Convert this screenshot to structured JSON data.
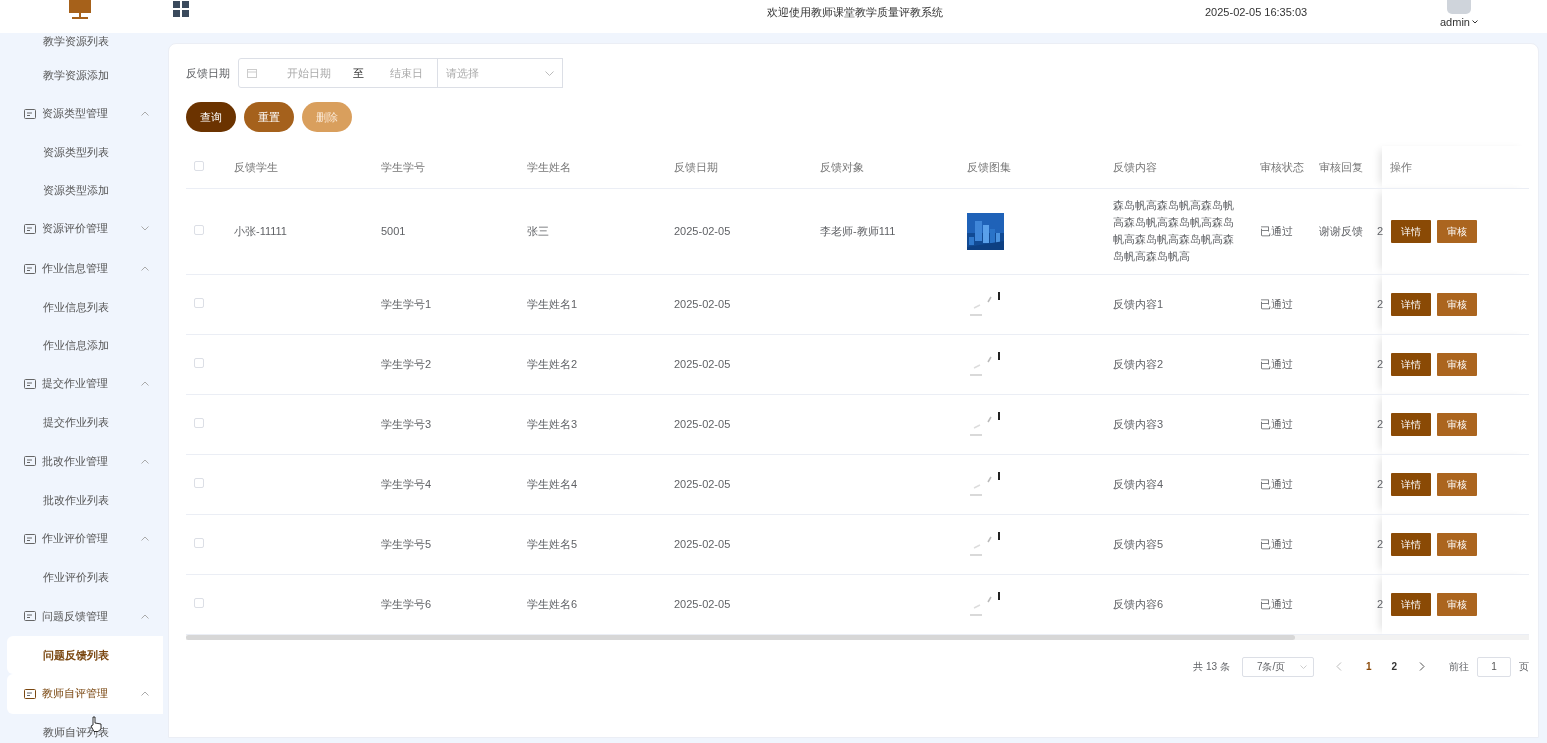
{
  "header": {
    "title": "欢迎使用教师课堂教学质量评教系统",
    "datetime": "2025-02-05 16:35:03",
    "user": "admin"
  },
  "sidebar": {
    "items": [
      {
        "label": "教学资源列表",
        "selected": false
      },
      {
        "label": "教学资源添加",
        "selected": false
      },
      {
        "label": "资源类型管理",
        "expanded": true,
        "children": [
          {
            "label": "资源类型列表",
            "selected": false
          },
          {
            "label": "资源类型添加",
            "selected": false
          }
        ]
      },
      {
        "label": "资源评价管理",
        "expanded": false
      },
      {
        "label": "作业信息管理",
        "expanded": true,
        "children": [
          {
            "label": "作业信息列表",
            "selected": false
          },
          {
            "label": "作业信息添加",
            "selected": false
          }
        ]
      },
      {
        "label": "提交作业管理",
        "expanded": true,
        "children": [
          {
            "label": "提交作业列表",
            "selected": false
          }
        ]
      },
      {
        "label": "批改作业管理",
        "expanded": true,
        "children": [
          {
            "label": "批改作业列表",
            "selected": false
          }
        ]
      },
      {
        "label": "作业评价管理",
        "expanded": true,
        "children": [
          {
            "label": "作业评价列表",
            "selected": false
          }
        ]
      },
      {
        "label": "问题反馈管理",
        "expanded": true,
        "children": [
          {
            "label": "问题反馈列表",
            "selected": true
          }
        ]
      },
      {
        "label": "教师自评管理",
        "expanded": true,
        "hovered": true,
        "children": [
          {
            "label": "教师自评列表",
            "selected": false
          }
        ]
      }
    ]
  },
  "filter": {
    "label": "反馈日期",
    "start_placeholder": "开始日期",
    "separator": "至",
    "end_placeholder": "结束日",
    "select_placeholder": "请选择"
  },
  "buttons": [
    {
      "label": "查询",
      "kind": "search",
      "disabled": false
    },
    {
      "label": "重置",
      "kind": "reset",
      "disabled": false
    },
    {
      "label": "删除",
      "kind": "delete",
      "disabled": true
    }
  ],
  "table": {
    "all_checked": false,
    "columns": [
      "反馈学生",
      "学生学号",
      "学生姓名",
      "反馈日期",
      "反馈对象",
      "反馈图集",
      "反馈内容",
      "审核状态",
      "审核回复",
      "",
      "操作"
    ],
    "rows": [
      {
        "checked": false,
        "student": "小张-11111",
        "student_no": "5001",
        "student_name": "张三",
        "date": "2025-02-05",
        "target": "李老师-教师111",
        "image": {
          "kind": "picture"
        },
        "content": "森岛帆高森岛帆高森岛帆高森岛帆高森岛帆高森岛帆高森岛帆高森岛帆高森岛帆高森岛帆高",
        "status": "已通过",
        "reply": "谢谢反馈",
        "column_10": "2",
        "actions": [
          "详情",
          "审核"
        ]
      },
      {
        "checked": false,
        "student": "",
        "student_no": "学生学号1",
        "student_name": "学生姓名1",
        "date": "2025-02-05",
        "target": "",
        "image": {
          "kind": "loading"
        },
        "content": "反馈内容1",
        "status": "已通过",
        "reply": "",
        "column_10": "2",
        "actions": [
          "详情",
          "审核"
        ]
      },
      {
        "checked": false,
        "student": "",
        "student_no": "学生学号2",
        "student_name": "学生姓名2",
        "date": "2025-02-05",
        "target": "",
        "image": {
          "kind": "loading"
        },
        "content": "反馈内容2",
        "status": "已通过",
        "reply": "",
        "column_10": "2",
        "actions": [
          "详情",
          "审核"
        ]
      },
      {
        "checked": false,
        "student": "",
        "student_no": "学生学号3",
        "student_name": "学生姓名3",
        "date": "2025-02-05",
        "target": "",
        "image": {
          "kind": "loading"
        },
        "content": "反馈内容3",
        "status": "已通过",
        "reply": "",
        "column_10": "2",
        "actions": [
          "详情",
          "审核"
        ]
      },
      {
        "checked": false,
        "student": "",
        "student_no": "学生学号4",
        "student_name": "学生姓名4",
        "date": "2025-02-05",
        "target": "",
        "image": {
          "kind": "loading"
        },
        "content": "反馈内容4",
        "status": "已通过",
        "reply": "",
        "column_10": "2",
        "actions": [
          "详情",
          "审核"
        ]
      },
      {
        "checked": false,
        "student": "",
        "student_no": "学生学号5",
        "student_name": "学生姓名5",
        "date": "2025-02-05",
        "target": "",
        "image": {
          "kind": "loading"
        },
        "content": "反馈内容5",
        "status": "已通过",
        "reply": "",
        "column_10": "2",
        "actions": [
          "详情",
          "审核"
        ]
      },
      {
        "checked": false,
        "student": "",
        "student_no": "学生学号6",
        "student_name": "学生姓名6",
        "date": "2025-02-05",
        "target": "",
        "image": {
          "kind": "loading"
        },
        "content": "反馈内容6",
        "status": "已通过",
        "reply": "",
        "column_10": "2",
        "actions": [
          "详情",
          "审核"
        ]
      }
    ]
  },
  "pagination": {
    "total": "共 13 条",
    "page_size": "7条/页",
    "pages": [
      {
        "label": "1",
        "selected": true
      },
      {
        "label": "2",
        "selected": false
      }
    ],
    "goto_label": "前往",
    "goto_value": "1",
    "page_suffix": "页"
  }
}
